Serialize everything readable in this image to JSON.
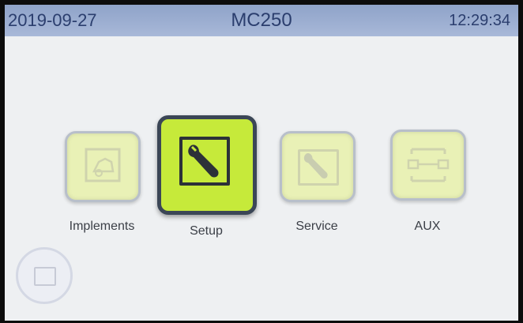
{
  "status_bar": {
    "date": "2019-09-27",
    "title": "MC250",
    "time": "12:29:34"
  },
  "menu": {
    "items": [
      {
        "label": "Implements",
        "icon": "implement-icon",
        "state": "disabled"
      },
      {
        "label": "Setup",
        "icon": "wrench-icon",
        "state": "selected"
      },
      {
        "label": "Service",
        "icon": "wrench-icon",
        "state": "disabled"
      },
      {
        "label": "AUX",
        "icon": "aux-connector-icon",
        "state": "disabled"
      }
    ]
  },
  "bottom_button": {
    "icon": "document-icon",
    "state": "disabled"
  },
  "colors": {
    "status_bar": "#9fb1d4",
    "title_text": "#2a3c70",
    "tile_selected": "#c6ea3a",
    "tile_disabled": "#e9f1b6",
    "screen_background": "#eef0f2"
  }
}
